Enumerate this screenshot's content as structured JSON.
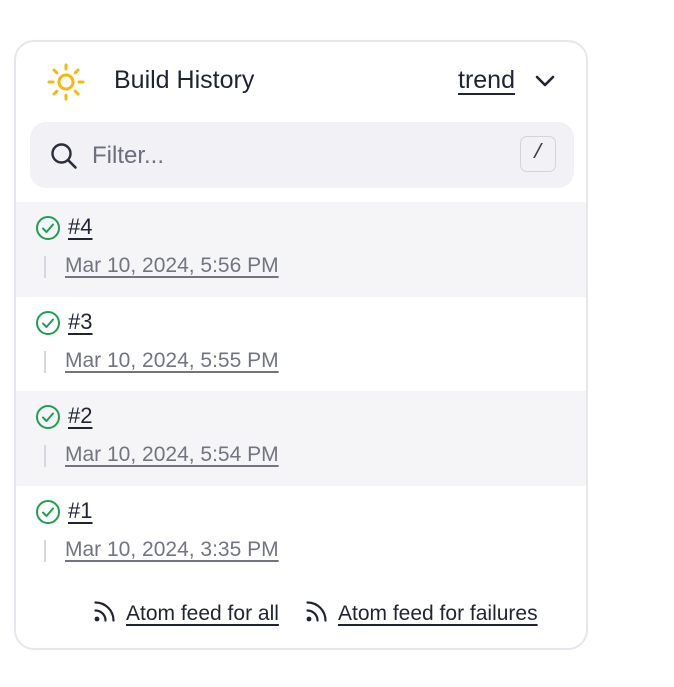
{
  "widget": {
    "title": "Build History",
    "trend_label": "trend",
    "icons": {
      "weather": "sun-icon",
      "expand": "chevron-down-icon",
      "search": "search-icon",
      "status": "check-circle-icon",
      "feed": "rss-icon"
    },
    "colors": {
      "sun": "#f5b90c",
      "success": "#1e9e52"
    }
  },
  "search": {
    "placeholder": "Filter...",
    "value": "",
    "shortcut": "/"
  },
  "builds": [
    {
      "number": "#4",
      "date": "Mar 10, 2024, 5:56 PM",
      "status": "success"
    },
    {
      "number": "#3",
      "date": "Mar 10, 2024, 5:55 PM",
      "status": "success"
    },
    {
      "number": "#2",
      "date": "Mar 10, 2024, 5:54 PM",
      "status": "success"
    },
    {
      "number": "#1",
      "date": "Mar 10, 2024, 3:35 PM",
      "status": "success"
    }
  ],
  "footer": {
    "feed_all": "Atom feed for all",
    "feed_failures": "Atom feed for failures"
  }
}
